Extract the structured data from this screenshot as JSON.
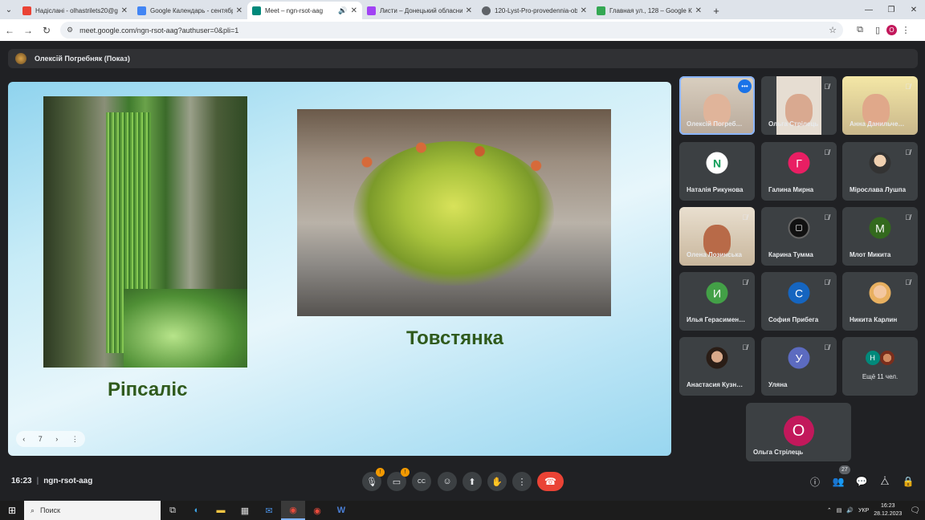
{
  "browser": {
    "tabs": [
      {
        "title": "Надіслані - olhastrilets20@gm",
        "fav_color": "#ea4335",
        "active": false
      },
      {
        "title": "Google Календарь - сентябрь",
        "fav_color": "#4285f4",
        "active": false
      },
      {
        "title": "Meet – ngn-rsot-aag",
        "fav_color": "#00897b",
        "active": true
      },
      {
        "title": "Листи – Донецький обласний",
        "fav_color": "#a142f4",
        "active": false
      },
      {
        "title": "120-Lyst-Pro-provedennia-obl",
        "fav_color": "#5f6368",
        "active": false
      },
      {
        "title": "Главная ул., 128 – Google Карт",
        "fav_color": "#34a853",
        "active": false
      }
    ],
    "new_tab_icon": "plus-icon",
    "url": "meet.google.com/ngn-rsot-aag?authuser=0&pli=1",
    "profile_initial": "O"
  },
  "presenter": {
    "label": "Олексій Погребняк (Показ)"
  },
  "slide": {
    "caption_left": "Ріпсаліс",
    "caption_right": "Товстянка",
    "page": "7"
  },
  "participants": [
    {
      "name": "Олексій Погреб…",
      "type": "video",
      "muted": false,
      "highlight": true
    },
    {
      "name": "Ольга Стрілець",
      "type": "video",
      "muted": true
    },
    {
      "name": "Анна Данильче…",
      "type": "video",
      "muted": true
    },
    {
      "name": "Наталія Рикунова",
      "type": "avatar",
      "initial": "N",
      "color": "#ffffff",
      "text_color": "#0f9d58",
      "muted": false
    },
    {
      "name": "Галина Мирна",
      "type": "avatar",
      "initial": "Г",
      "color": "#e91e63",
      "muted": true
    },
    {
      "name": "Мірослава Лушпа",
      "type": "photo",
      "muted": true
    },
    {
      "name": "Олена Лозинська",
      "type": "video",
      "muted": true
    },
    {
      "name": "Карина Тумма",
      "type": "photo",
      "muted": true
    },
    {
      "name": "Млот Микита",
      "type": "avatar",
      "initial": "М",
      "color": "#33691e",
      "muted": true
    },
    {
      "name": "Илья Герасимен…",
      "type": "avatar",
      "initial": "И",
      "color": "#43a047",
      "muted": true
    },
    {
      "name": "София Прибега",
      "type": "avatar",
      "initial": "С",
      "color": "#1565c0",
      "muted": true
    },
    {
      "name": "Никита Карлин",
      "type": "photo",
      "muted": true
    },
    {
      "name": "Анастасия Кузн…",
      "type": "photo",
      "muted": true
    },
    {
      "name": "Уляна",
      "type": "avatar",
      "initial": "У",
      "color": "#5c6bc0",
      "muted": true
    },
    {
      "name": "Ещё 11 чел.",
      "type": "more",
      "initial": "Н",
      "muted": false
    },
    {
      "name": "Ольга Стрілець",
      "type": "avatar",
      "initial": "О",
      "color": "#c2185b",
      "muted": false
    }
  ],
  "controls": {
    "time": "16:23",
    "meeting_code": "ngn-rsot-aag",
    "participant_count": "27"
  },
  "taskbar": {
    "search_placeholder": "Поиск",
    "lang": "УКР",
    "clock_time": "16:23",
    "clock_date": "28.12.2023"
  }
}
